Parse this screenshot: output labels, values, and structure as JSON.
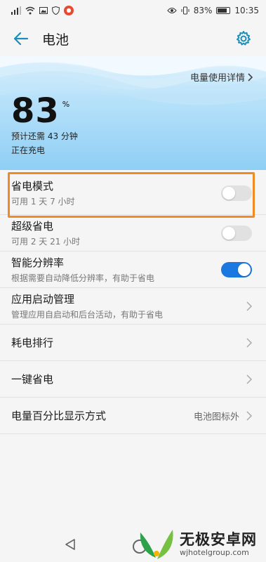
{
  "status_bar": {
    "battery_text": "83%",
    "time": "10:35",
    "battery_level": 0.83
  },
  "header": {
    "title": "电池"
  },
  "hero": {
    "usage_link": "电量使用详情",
    "battery_number": "83",
    "battery_unit": "%",
    "remaining": "预计还需 43 分钟",
    "charging": "正在充电"
  },
  "items": [
    {
      "title": "省电模式",
      "subtitle": "可用 1 天 7 小时",
      "control": "toggle",
      "on": false,
      "highlighted": true
    },
    {
      "title": "超级省电",
      "subtitle": "可用 2 天 21 小时",
      "control": "toggle",
      "on": false
    },
    {
      "title": "智能分辨率",
      "subtitle": "根据需要自动降低分辨率，有助于省电",
      "control": "toggle",
      "on": true
    },
    {
      "title": "应用启动管理",
      "subtitle": "管理应用自启动和后台活动，有助于省电",
      "control": "chevron"
    },
    {
      "title": "耗电排行",
      "control": "chevron"
    },
    {
      "title": "一键省电",
      "control": "chevron"
    },
    {
      "title": "电量百分比显示方式",
      "value": "电池图标外",
      "control": "chevron"
    }
  ],
  "watermark": {
    "title": "无极安卓网",
    "url": "wjhotelgroup.com"
  },
  "colors": {
    "accent": "#1a78e0",
    "highlight": "#f08a24",
    "header_teal": "#1d8eb8"
  }
}
